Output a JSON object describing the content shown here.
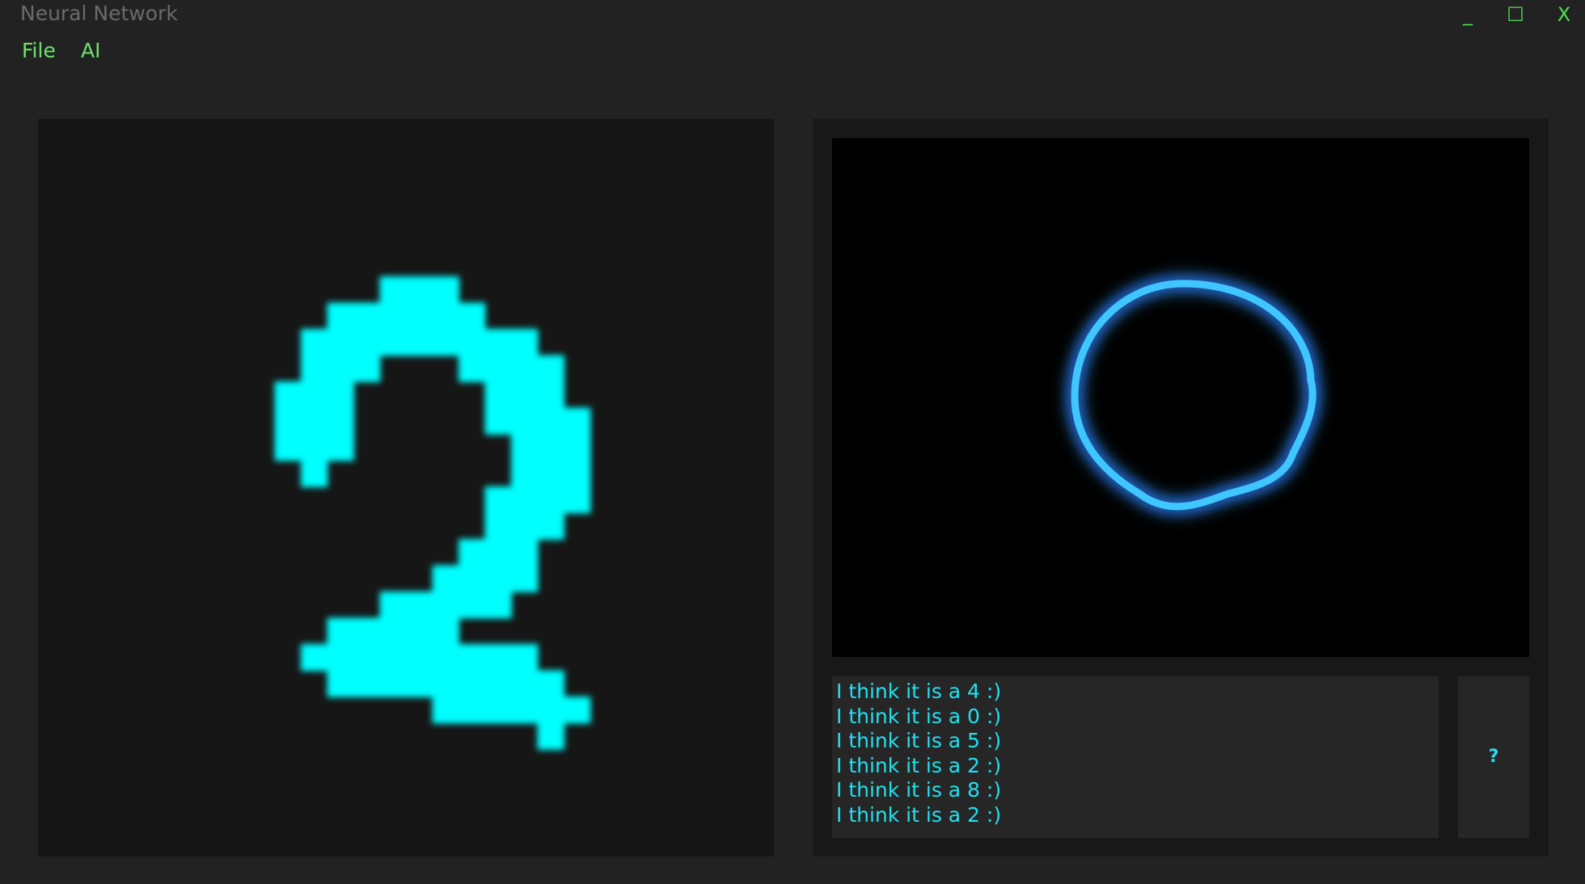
{
  "window": {
    "title": "Neural Network",
    "controls": {
      "minimize": "_",
      "maximize": "☐",
      "close": "X"
    }
  },
  "menu": {
    "items": [
      "File",
      "AI"
    ]
  },
  "canvas": {
    "stroke_color": "#00ffff",
    "background": "#161616",
    "drawn_digit_icon": "handwritten-digit-two"
  },
  "visualizer": {
    "background": "#000000",
    "ring_color": "#3fc6ff",
    "glow_color": "#1f4fff"
  },
  "log": {
    "lines": [
      "I think it is a 4 :)",
      "I think it is a 0 :)",
      "I think it is a 5 :)",
      "I think it is a 2 :)",
      "I think it is a 8 :)",
      "I think it is a 2 :)"
    ]
  },
  "help_button": {
    "label": "?"
  }
}
